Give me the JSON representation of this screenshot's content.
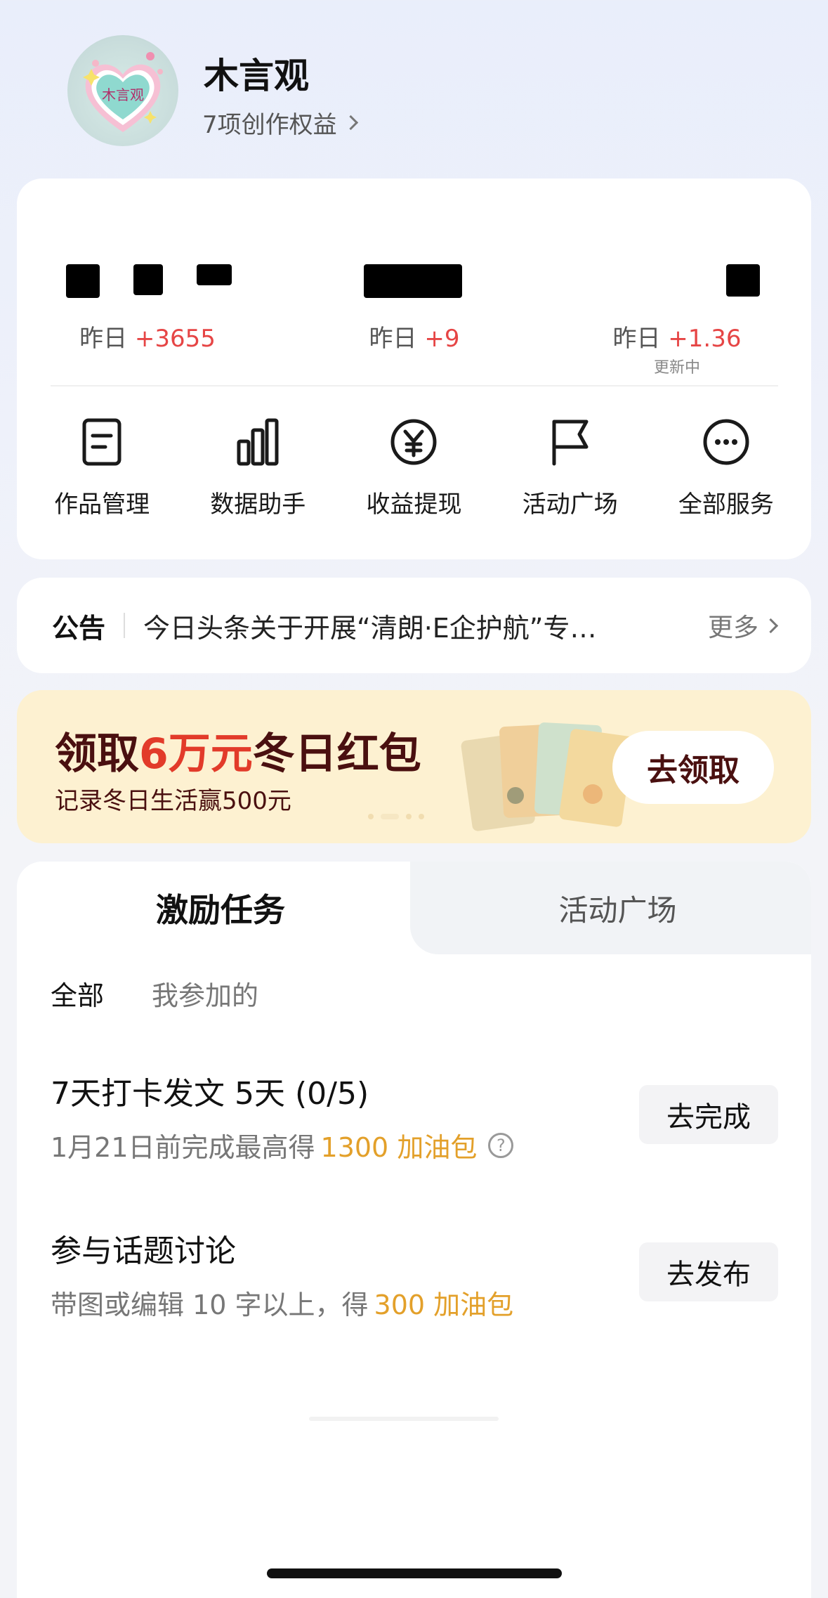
{
  "profile": {
    "name": "木言观",
    "avatar_text": "木言观",
    "benefits": "7项创作权益"
  },
  "stats": {
    "items": [
      {
        "yesterday_label": "昨日",
        "yesterday_value": "+3655",
        "note": ""
      },
      {
        "yesterday_label": "昨日",
        "yesterday_value": "+9",
        "note": ""
      },
      {
        "yesterday_label": "昨日",
        "yesterday_value": "+1.36",
        "note": "更新中"
      }
    ]
  },
  "tools": [
    {
      "label": "作品管理",
      "icon": "document-icon"
    },
    {
      "label": "数据助手",
      "icon": "bar-chart-icon"
    },
    {
      "label": "收益提现",
      "icon": "yen-icon"
    },
    {
      "label": "活动广场",
      "icon": "flag-icon"
    },
    {
      "label": "全部服务",
      "icon": "more-icon"
    }
  ],
  "notice": {
    "title": "公告",
    "text": "今日头条关于开展“清朗·E企护航”专…",
    "more": "更多"
  },
  "banner": {
    "title_pre": "领取",
    "title_highlight": "6万元",
    "title_post": "冬日红包",
    "subtitle": "记录冬日生活赢500元",
    "button": "去领取"
  },
  "tasks": {
    "tab_active": "激励任务",
    "tab_inactive": "活动广场",
    "filter_all": "全部",
    "filter_mine": "我参加的",
    "items": [
      {
        "title": "7天打卡发文 5天 (0/5)",
        "desc_prefix": "1月21日前完成最高得",
        "reward": "1300 加油包",
        "help": "?",
        "button": "去完成"
      },
      {
        "title": "参与话题讨论",
        "desc_prefix": "带图或编辑 10 字以上，得",
        "reward": "300 加油包",
        "button": "去发布"
      }
    ]
  },
  "colors": {
    "accent_red": "#e64545",
    "reward_orange": "#e3a02a",
    "banner_bg": "#fdf1d1",
    "banner_text": "#4a1010"
  }
}
